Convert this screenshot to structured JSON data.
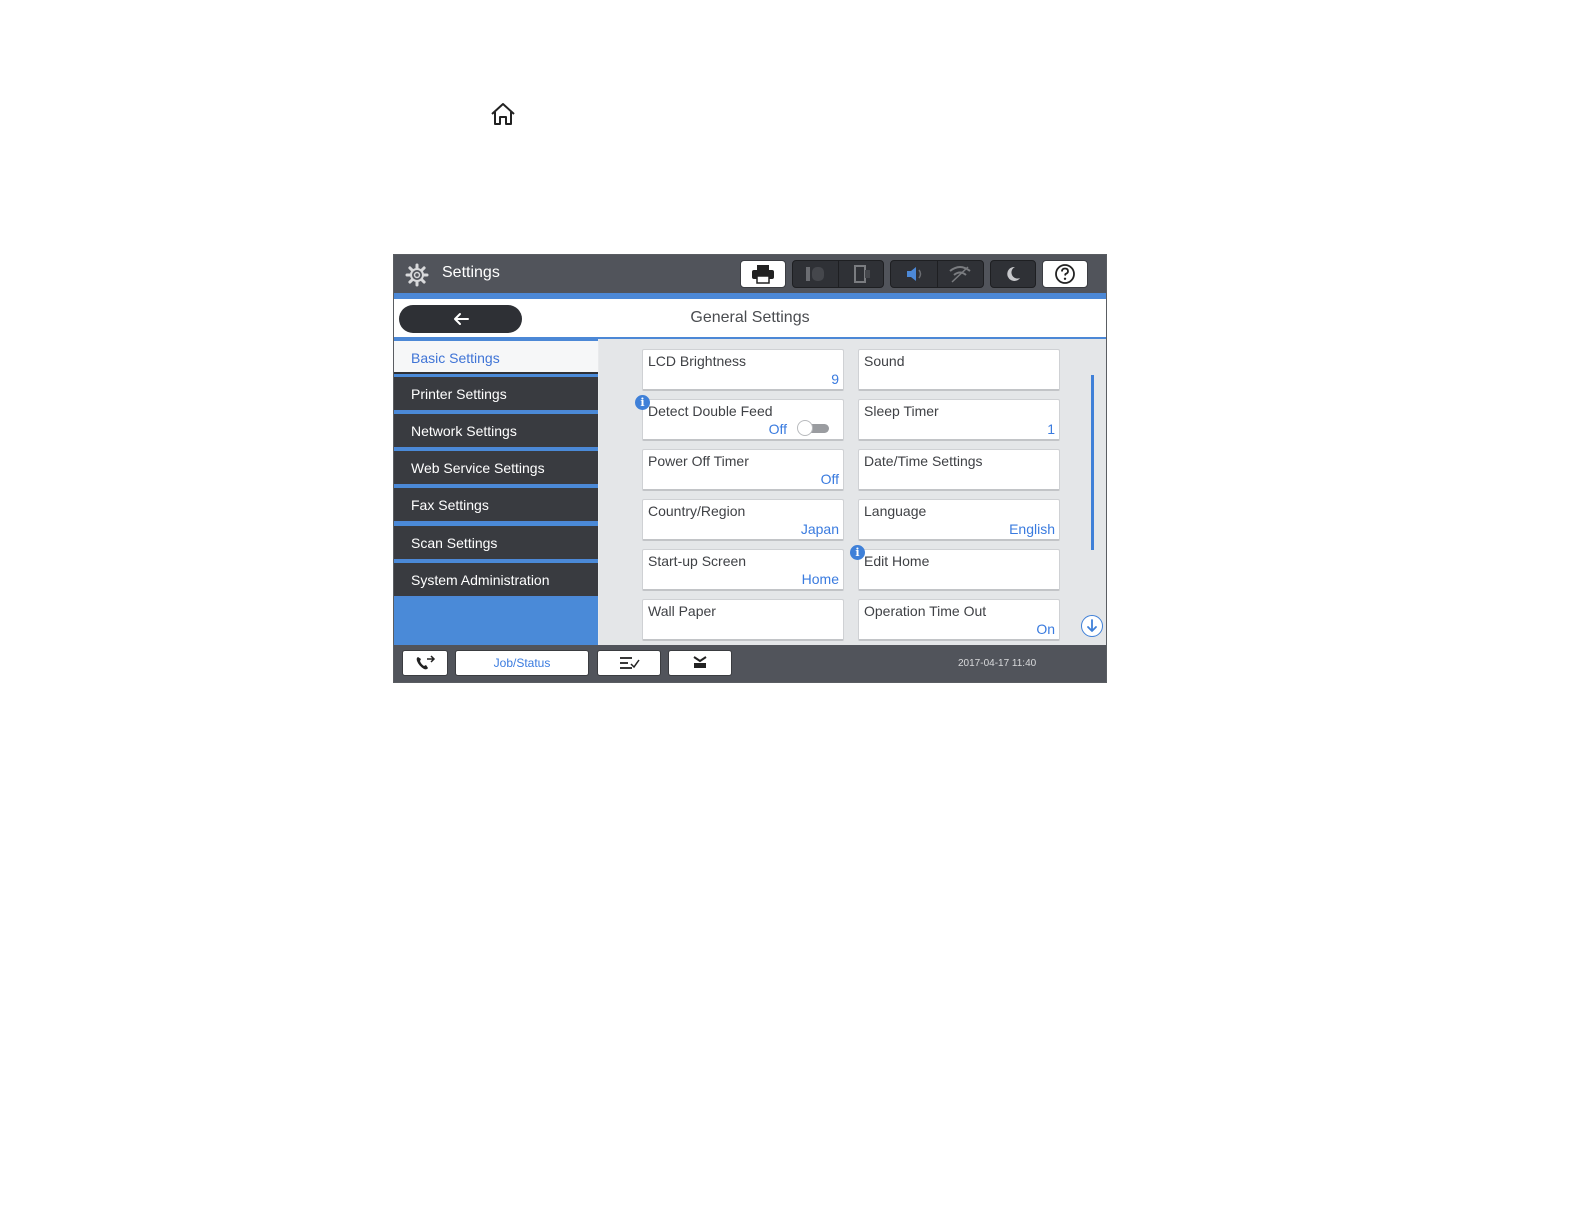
{
  "colors": {
    "accent": "#4c88d6",
    "value_blue": "#3a7bdf",
    "dark_bar": "#51545b",
    "sidebar_item": "#393b40"
  },
  "page_icon": "home-icon",
  "topbar": {
    "title": "Settings",
    "icons": [
      "gear-icon",
      "printer-icon",
      "ink-status-icon",
      "paper-status-icon",
      "speaker-icon",
      "wifi-off-icon",
      "sleep-moon-icon",
      "help-icon"
    ]
  },
  "header": {
    "back_icon": "arrow-left-icon",
    "title": "General Settings"
  },
  "sidebar": {
    "items": [
      {
        "label": "Basic Settings",
        "active": true
      },
      {
        "label": "Printer Settings"
      },
      {
        "label": "Network Settings"
      },
      {
        "label": "Web Service Settings"
      },
      {
        "label": "Fax Settings"
      },
      {
        "label": "Scan Settings"
      },
      {
        "label": "System Administration"
      }
    ]
  },
  "settings": [
    {
      "label": "LCD Brightness",
      "value": "9"
    },
    {
      "label": "Sound",
      "value": ""
    },
    {
      "label": "Detect Double Feed",
      "value": "Off",
      "toggle": true,
      "toggle_on": false,
      "info": true
    },
    {
      "label": "Sleep Timer",
      "value": "1"
    },
    {
      "label": "Power Off Timer",
      "value": "Off"
    },
    {
      "label": "Date/Time Settings",
      "value": ""
    },
    {
      "label": "Country/Region",
      "value": "Japan"
    },
    {
      "label": "Language",
      "value": "English"
    },
    {
      "label": "Start-up Screen",
      "value": "Home"
    },
    {
      "label": "Edit Home",
      "value": "",
      "info": true
    },
    {
      "label": "Wall Paper",
      "value": ""
    },
    {
      "label": "Operation Time Out",
      "value": "On"
    }
  ],
  "bottombar": {
    "job_status_label": "Job/Status",
    "icons": [
      "phone-transfer-icon",
      "job-list-icon",
      "paper-feed-icon"
    ],
    "datetime": "2017-04-17 11:40"
  }
}
